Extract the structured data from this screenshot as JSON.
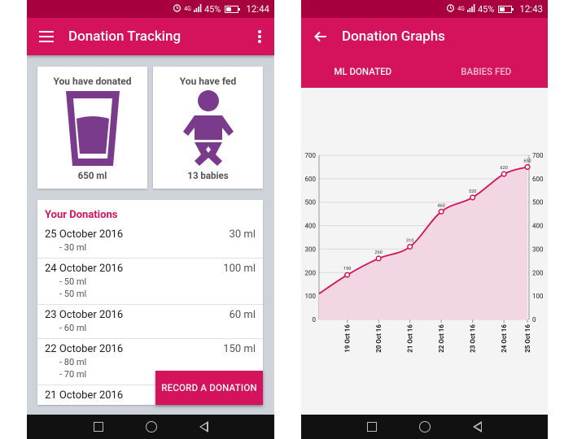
{
  "screen1": {
    "status": {
      "network": "4G",
      "battery": "45%",
      "time": "12:44",
      "battery_level": 0.45
    },
    "title": "Donation Tracking",
    "stats": [
      {
        "label": "You have donated",
        "value": "650 ml"
      },
      {
        "label": "You have fed",
        "value": "13 babies"
      }
    ],
    "donations_header": "Your Donations",
    "donations": [
      {
        "date": "25 October 2016",
        "total": "30 ml",
        "items": [
          "- 30 ml"
        ]
      },
      {
        "date": "24 October 2016",
        "total": "100 ml",
        "items": [
          "- 50 ml",
          "- 50 ml"
        ]
      },
      {
        "date": "23 October 2016",
        "total": "60 ml",
        "items": [
          "- 60 ml"
        ]
      },
      {
        "date": "22 October 2016",
        "total": "150 ml",
        "items": [
          "- 80 ml",
          "- 70 ml"
        ]
      },
      {
        "date": "21 October 2016",
        "total": "",
        "items": []
      }
    ],
    "record_button": "RECORD A DONATION"
  },
  "screen2": {
    "status": {
      "network": "4G",
      "battery": "45%",
      "time": "12:43",
      "battery_level": 0.45
    },
    "title": "Donation Graphs",
    "tabs": [
      {
        "label": "ML DONATED",
        "active": true
      },
      {
        "label": "BABIES FED",
        "active": false
      }
    ]
  },
  "colors": {
    "primary": "#d5135c",
    "status_bar": "#a8003f",
    "accent_purple": "#7b3b8c",
    "area_fill": "#f3d6e3"
  },
  "chart_data": {
    "type": "area",
    "x": [
      "19 Oct 16",
      "20 Oct 16",
      "21 Oct 16",
      "22 Oct 16",
      "23 Oct 16",
      "24 Oct 16",
      "25 Oct 16"
    ],
    "values": [
      190,
      260,
      310,
      460,
      520,
      620,
      650
    ],
    "start_value": 110,
    "data_labels": [
      "190",
      "260",
      "310",
      "460",
      "520",
      "620",
      "650"
    ],
    "yticks": [
      0,
      100,
      200,
      300,
      400,
      500,
      600,
      700
    ],
    "ylim": [
      0,
      700
    ],
    "grid": true,
    "dual_axis": true
  }
}
